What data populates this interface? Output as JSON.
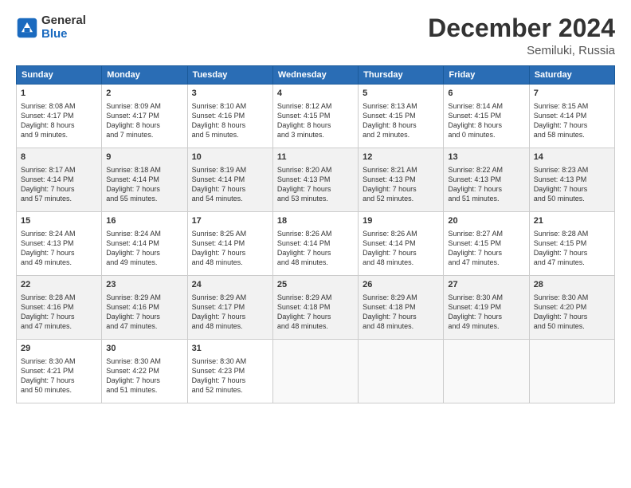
{
  "header": {
    "logo_line1": "General",
    "logo_line2": "Blue",
    "month": "December 2024",
    "location": "Semiluki, Russia"
  },
  "days_of_week": [
    "Sunday",
    "Monday",
    "Tuesday",
    "Wednesday",
    "Thursday",
    "Friday",
    "Saturday"
  ],
  "weeks": [
    [
      {
        "day": 1,
        "lines": [
          "Sunrise: 8:08 AM",
          "Sunset: 4:17 PM",
          "Daylight: 8 hours",
          "and 9 minutes."
        ]
      },
      {
        "day": 2,
        "lines": [
          "Sunrise: 8:09 AM",
          "Sunset: 4:17 PM",
          "Daylight: 8 hours",
          "and 7 minutes."
        ]
      },
      {
        "day": 3,
        "lines": [
          "Sunrise: 8:10 AM",
          "Sunset: 4:16 PM",
          "Daylight: 8 hours",
          "and 5 minutes."
        ]
      },
      {
        "day": 4,
        "lines": [
          "Sunrise: 8:12 AM",
          "Sunset: 4:15 PM",
          "Daylight: 8 hours",
          "and 3 minutes."
        ]
      },
      {
        "day": 5,
        "lines": [
          "Sunrise: 8:13 AM",
          "Sunset: 4:15 PM",
          "Daylight: 8 hours",
          "and 2 minutes."
        ]
      },
      {
        "day": 6,
        "lines": [
          "Sunrise: 8:14 AM",
          "Sunset: 4:15 PM",
          "Daylight: 8 hours",
          "and 0 minutes."
        ]
      },
      {
        "day": 7,
        "lines": [
          "Sunrise: 8:15 AM",
          "Sunset: 4:14 PM",
          "Daylight: 7 hours",
          "and 58 minutes."
        ]
      }
    ],
    [
      {
        "day": 8,
        "lines": [
          "Sunrise: 8:17 AM",
          "Sunset: 4:14 PM",
          "Daylight: 7 hours",
          "and 57 minutes."
        ]
      },
      {
        "day": 9,
        "lines": [
          "Sunrise: 8:18 AM",
          "Sunset: 4:14 PM",
          "Daylight: 7 hours",
          "and 55 minutes."
        ]
      },
      {
        "day": 10,
        "lines": [
          "Sunrise: 8:19 AM",
          "Sunset: 4:14 PM",
          "Daylight: 7 hours",
          "and 54 minutes."
        ]
      },
      {
        "day": 11,
        "lines": [
          "Sunrise: 8:20 AM",
          "Sunset: 4:13 PM",
          "Daylight: 7 hours",
          "and 53 minutes."
        ]
      },
      {
        "day": 12,
        "lines": [
          "Sunrise: 8:21 AM",
          "Sunset: 4:13 PM",
          "Daylight: 7 hours",
          "and 52 minutes."
        ]
      },
      {
        "day": 13,
        "lines": [
          "Sunrise: 8:22 AM",
          "Sunset: 4:13 PM",
          "Daylight: 7 hours",
          "and 51 minutes."
        ]
      },
      {
        "day": 14,
        "lines": [
          "Sunrise: 8:23 AM",
          "Sunset: 4:13 PM",
          "Daylight: 7 hours",
          "and 50 minutes."
        ]
      }
    ],
    [
      {
        "day": 15,
        "lines": [
          "Sunrise: 8:24 AM",
          "Sunset: 4:13 PM",
          "Daylight: 7 hours",
          "and 49 minutes."
        ]
      },
      {
        "day": 16,
        "lines": [
          "Sunrise: 8:24 AM",
          "Sunset: 4:14 PM",
          "Daylight: 7 hours",
          "and 49 minutes."
        ]
      },
      {
        "day": 17,
        "lines": [
          "Sunrise: 8:25 AM",
          "Sunset: 4:14 PM",
          "Daylight: 7 hours",
          "and 48 minutes."
        ]
      },
      {
        "day": 18,
        "lines": [
          "Sunrise: 8:26 AM",
          "Sunset: 4:14 PM",
          "Daylight: 7 hours",
          "and 48 minutes."
        ]
      },
      {
        "day": 19,
        "lines": [
          "Sunrise: 8:26 AM",
          "Sunset: 4:14 PM",
          "Daylight: 7 hours",
          "and 48 minutes."
        ]
      },
      {
        "day": 20,
        "lines": [
          "Sunrise: 8:27 AM",
          "Sunset: 4:15 PM",
          "Daylight: 7 hours",
          "and 47 minutes."
        ]
      },
      {
        "day": 21,
        "lines": [
          "Sunrise: 8:28 AM",
          "Sunset: 4:15 PM",
          "Daylight: 7 hours",
          "and 47 minutes."
        ]
      }
    ],
    [
      {
        "day": 22,
        "lines": [
          "Sunrise: 8:28 AM",
          "Sunset: 4:16 PM",
          "Daylight: 7 hours",
          "and 47 minutes."
        ]
      },
      {
        "day": 23,
        "lines": [
          "Sunrise: 8:29 AM",
          "Sunset: 4:16 PM",
          "Daylight: 7 hours",
          "and 47 minutes."
        ]
      },
      {
        "day": 24,
        "lines": [
          "Sunrise: 8:29 AM",
          "Sunset: 4:17 PM",
          "Daylight: 7 hours",
          "and 48 minutes."
        ]
      },
      {
        "day": 25,
        "lines": [
          "Sunrise: 8:29 AM",
          "Sunset: 4:18 PM",
          "Daylight: 7 hours",
          "and 48 minutes."
        ]
      },
      {
        "day": 26,
        "lines": [
          "Sunrise: 8:29 AM",
          "Sunset: 4:18 PM",
          "Daylight: 7 hours",
          "and 48 minutes."
        ]
      },
      {
        "day": 27,
        "lines": [
          "Sunrise: 8:30 AM",
          "Sunset: 4:19 PM",
          "Daylight: 7 hours",
          "and 49 minutes."
        ]
      },
      {
        "day": 28,
        "lines": [
          "Sunrise: 8:30 AM",
          "Sunset: 4:20 PM",
          "Daylight: 7 hours",
          "and 50 minutes."
        ]
      }
    ],
    [
      {
        "day": 29,
        "lines": [
          "Sunrise: 8:30 AM",
          "Sunset: 4:21 PM",
          "Daylight: 7 hours",
          "and 50 minutes."
        ]
      },
      {
        "day": 30,
        "lines": [
          "Sunrise: 8:30 AM",
          "Sunset: 4:22 PM",
          "Daylight: 7 hours",
          "and 51 minutes."
        ]
      },
      {
        "day": 31,
        "lines": [
          "Sunrise: 8:30 AM",
          "Sunset: 4:23 PM",
          "Daylight: 7 hours",
          "and 52 minutes."
        ]
      },
      null,
      null,
      null,
      null
    ]
  ]
}
